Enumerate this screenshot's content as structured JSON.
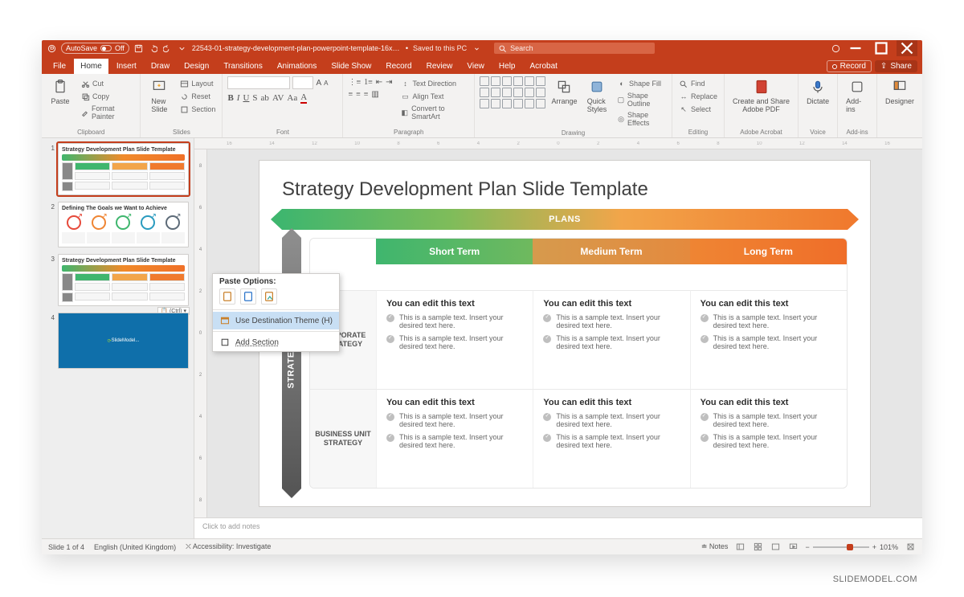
{
  "titlebar": {
    "autosave_label": "AutoSave",
    "autosave_state": "Off",
    "filename": "22543-01-strategy-development-plan-powerpoint-template-16x9-1...",
    "saved_status": "Saved to this PC",
    "search_placeholder": "Search"
  },
  "tabs": [
    "File",
    "Home",
    "Insert",
    "Draw",
    "Design",
    "Transitions",
    "Animations",
    "Slide Show",
    "Record",
    "Review",
    "View",
    "Help",
    "Acrobat"
  ],
  "tabs_active": "Home",
  "tabs_right": {
    "record": "Record",
    "share": "Share"
  },
  "ribbon": {
    "clipboard": {
      "paste": "Paste",
      "cut": "Cut",
      "copy": "Copy",
      "format_painter": "Format Painter",
      "label": "Clipboard"
    },
    "slides": {
      "new_slide": "New\nSlide",
      "layout": "Layout",
      "reset": "Reset",
      "section": "Section",
      "label": "Slides"
    },
    "font": {
      "size_up": "A",
      "size_dn": "A",
      "label": "Font"
    },
    "paragraph": {
      "text_direction": "Text Direction",
      "align_text": "Align Text",
      "convert": "Convert to SmartArt",
      "label": "Paragraph"
    },
    "drawing": {
      "arrange": "Arrange",
      "quick_styles": "Quick\nStyles",
      "shape_fill": "Shape Fill",
      "shape_outline": "Shape Outline",
      "shape_effects": "Shape Effects",
      "label": "Drawing"
    },
    "editing": {
      "find": "Find",
      "replace": "Replace",
      "select": "Select",
      "label": "Editing"
    },
    "adobe": {
      "create_share": "Create and Share\nAdobe PDF",
      "label": "Adobe Acrobat"
    },
    "voice": {
      "dictate": "Dictate",
      "label": "Voice"
    },
    "addins": {
      "addins": "Add-ins",
      "label": "Add-ins"
    },
    "designer": {
      "designer": "Designer"
    }
  },
  "thumbs": {
    "slides": [
      {
        "title": "Strategy Development Plan Slide Template"
      },
      {
        "title": "Defining The Goals we Want to Achieve"
      },
      {
        "title": "Strategy Development Plan Slide Template"
      },
      {
        "title": ""
      }
    ],
    "ctrl_tag": "(Ctrl)"
  },
  "context_menu": {
    "paste_options": "Paste Options:",
    "use_dest": "Use Destination Theme (H)",
    "add_section": "Add Section"
  },
  "slide": {
    "title": "Strategy Development Plan Slide Template",
    "plans": "PLANS",
    "strategy": "STRATEGY",
    "cols": [
      "Short Term",
      "Medium Term",
      "Long Term"
    ],
    "rows": [
      "CORPORATE STRATEGY",
      "BUSINESS UNIT STRATEGY"
    ],
    "cell_heading": "You can edit this text",
    "bullet": "This is a sample text. Insert your desired text here."
  },
  "target_colors": [
    "#e64a3b",
    "#ef8533",
    "#3fb66e",
    "#2a9bbf",
    "#5d6b78"
  ],
  "notes_placeholder": "Click to add notes",
  "statusbar": {
    "slide_pos": "Slide 1 of 4",
    "lang": "English (United Kingdom)",
    "access": "Accessibility: Investigate",
    "notes": "Notes",
    "zoom": "101%"
  },
  "brand": "SLIDEMODEL.COM"
}
